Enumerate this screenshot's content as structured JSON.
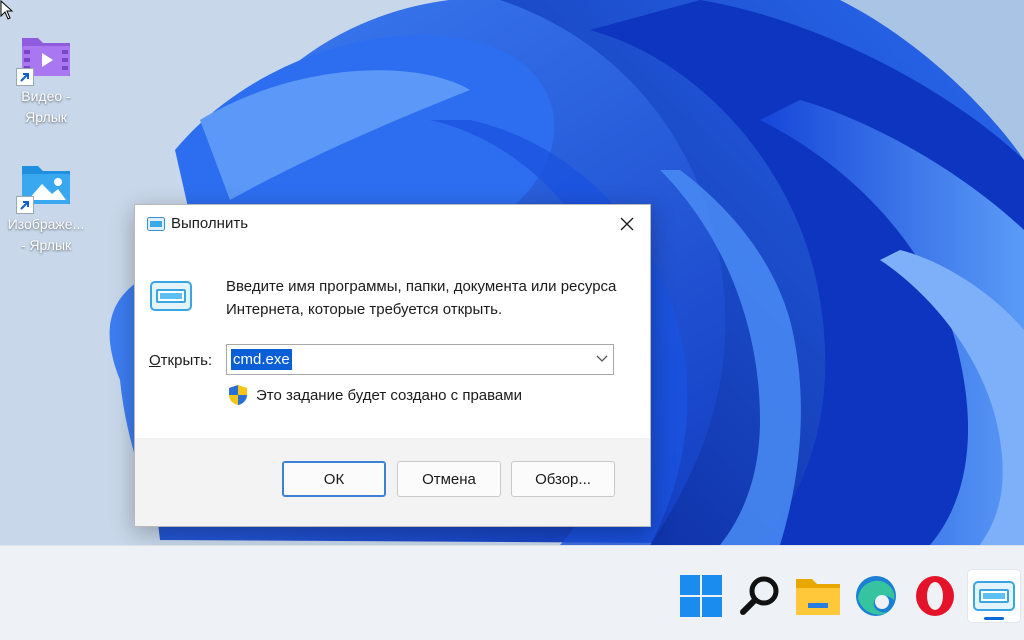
{
  "desktop": {
    "icons": [
      {
        "label": "Видео -\nЯрлык",
        "icon": "video-folder-icon"
      },
      {
        "label": "Изображе...\n- Ярлык",
        "icon": "pictures-folder-icon"
      }
    ]
  },
  "run_dialog": {
    "title": "Выполнить",
    "description": "Введите имя программы, папки, документа или ресурса Интернета, которые требуется открыть.",
    "open_label_accel": "О",
    "open_label_rest": "ткрыть:",
    "input_value": "cmd.exe",
    "admin_note": "Это задание будет создано с правами",
    "buttons": {
      "ok": "ОК",
      "cancel": "Отмена",
      "browse": "Обзор..."
    }
  },
  "taskbar": {
    "items": [
      "start-icon",
      "search-icon",
      "file-explorer-icon",
      "edge-icon",
      "opera-icon",
      "run-app-icon"
    ],
    "active": "run-app-icon"
  },
  "colors": {
    "accent": "#0a5fd6",
    "wallpaper_blue": "#1f5ee8",
    "selection": "#0a5fd6"
  }
}
